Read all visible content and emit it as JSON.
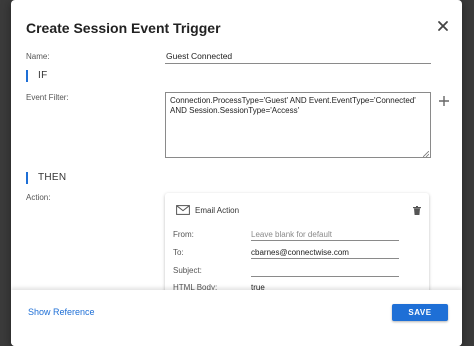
{
  "dialog": {
    "title": "Create Session Event Trigger"
  },
  "name_field": {
    "label": "Name:",
    "value": "Guest Connected"
  },
  "if_section": {
    "label": "IF"
  },
  "event_filter": {
    "label": "Event Filter:",
    "value": "Connection.ProcessType='Guest' AND Event.EventType='Connected' AND Session.SessionType='Access'"
  },
  "then_section": {
    "label": "THEN"
  },
  "action": {
    "label": "Action:",
    "card_title": "Email Action",
    "fields": {
      "from": {
        "label": "From:",
        "value": "",
        "placeholder": "Leave blank for default"
      },
      "to": {
        "label": "To:",
        "value": "cbarnes@connectwise.com"
      },
      "subject": {
        "label": "Subject:",
        "value": ""
      },
      "html_body": {
        "label": "HTML Body:",
        "value": "true"
      }
    }
  },
  "footer": {
    "show_reference": "Show Reference",
    "save": "SAVE"
  },
  "colors": {
    "accent": "#1e6fd6",
    "backdrop": "#3b3b3b"
  },
  "icons": {
    "close": "close-icon",
    "add": "plus-icon",
    "email": "envelope-icon",
    "delete": "trash-icon"
  }
}
